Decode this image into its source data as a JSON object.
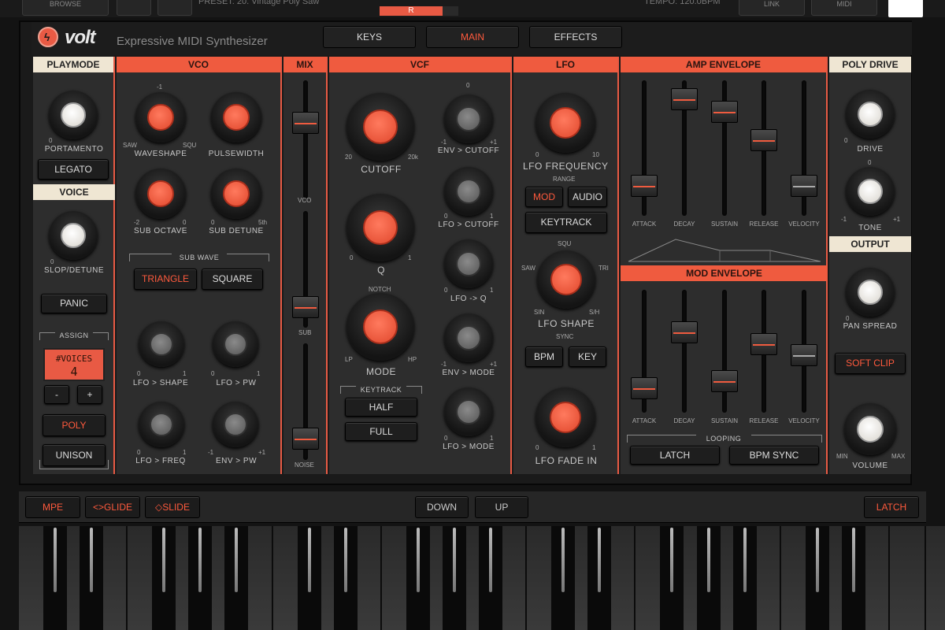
{
  "topbar": {
    "browse": "BROWSE",
    "preset": "PRESET: 20. Vintage Poly Saw",
    "meter": "R",
    "tempo": "TEMPO: 120.0BPM",
    "link": "LINK",
    "midi": "MIDI"
  },
  "header": {
    "brand": "volt",
    "tagline": "Expressive MIDI Synthesizer",
    "tabs": [
      {
        "label": "KEYS"
      },
      {
        "label": "MAIN"
      },
      {
        "label": "EFFECTS"
      }
    ],
    "active_tab": "MAIN"
  },
  "playmode": {
    "title": "PLAYMODE",
    "portamento": "PORTAMENTO",
    "portamento_min": "0",
    "legato": "LEGATO"
  },
  "voice": {
    "title": "VOICE",
    "slop": "SLOP/DETUNE",
    "slop_min": "0",
    "panic": "PANIC",
    "assign": "ASSIGN",
    "voices_label": "#VOICES",
    "voices_value": "4",
    "minus": "-",
    "plus": "+",
    "poly": "POLY",
    "unison": "UNISON"
  },
  "vco": {
    "title": "VCO",
    "waveshape": "WAVESHAPE",
    "waveshape_top": "-1",
    "saw": "SAW",
    "squ": "SQU",
    "pulsewidth": "PULSEWIDTH",
    "sub_octave": "SUB OCTAVE",
    "sub_min": "-2",
    "sub_max": "0",
    "sub_detune": "SUB DETUNE",
    "detune_min": "0",
    "detune_max": "5th",
    "sub_wave": "SUB WAVE",
    "triangle": "TRIANGLE",
    "square": "SQUARE",
    "lfo_shape": "LFO > SHAPE",
    "lfo_pw": "LFO > PW",
    "lfo_freq": "LFO > FREQ",
    "env_pw": "ENV > PW",
    "zero": "0",
    "one": "1",
    "neg1": "-1",
    "pos1": "+1"
  },
  "mix": {
    "title": "MIX",
    "vco": "VCO",
    "sub": "SUB",
    "noise": "NOISE"
  },
  "vcf": {
    "title": "VCF",
    "cutoff": "CUTOFF",
    "cutoff_min": "20",
    "cutoff_max": "20k",
    "q": "Q",
    "q_min": "0",
    "q_max": "1",
    "mode": "MODE",
    "notch": "NOTCH",
    "lp": "LP",
    "hp": "HP",
    "keytrack": "KEYTRACK",
    "half": "HALF",
    "full": "FULL",
    "env_cutoff": "ENV > CUTOFF",
    "lfo_cutoff": "LFO > CUTOFF",
    "lfo_q": "LFO -> Q",
    "env_mode": "ENV > MODE",
    "lfo_mode": "LFO > MODE",
    "zero": "0",
    "one": "1",
    "neg1": "-1",
    "pos1": "+1"
  },
  "lfo": {
    "title": "LFO",
    "frequency": "LFO FREQUENCY",
    "freq_min": "0",
    "freq_max": "10",
    "range": "RANGE",
    "mod": "MOD",
    "audio": "AUDIO",
    "keytrack": "KEYTRACK",
    "shape": "LFO SHAPE",
    "squ": "SQU",
    "saw": "SAW",
    "tri": "TRI",
    "sin": "SIN",
    "sh": "S/H",
    "sync": "SYNC",
    "bpm": "BPM",
    "key": "KEY",
    "fade_in": "LFO FADE IN",
    "zero": "0",
    "one": "1"
  },
  "amp_env": {
    "title": "AMP ENVELOPE",
    "labels": [
      "ATTACK",
      "DECAY",
      "SUSTAIN",
      "RELEASE",
      "VELOCITY"
    ],
    "levels": [
      0.17,
      0.93,
      0.82,
      0.57,
      0.17
    ]
  },
  "mod_env": {
    "title": "MOD ENVELOPE",
    "labels": [
      "ATTACK",
      "DECAY",
      "SUSTAIN",
      "RELEASE",
      "VELOCITY"
    ],
    "levels": [
      0.13,
      0.69,
      0.2,
      0.57,
      0.46
    ],
    "looping": "LOOPING",
    "latch": "LATCH",
    "bpm_sync": "BPM SYNC"
  },
  "poly_drive": {
    "title": "POLY DRIVE",
    "drive": "DRIVE",
    "drive_min": "0",
    "drive_top": "0",
    "tone": "TONE",
    "tone_min": "-1",
    "tone_max": "+1"
  },
  "output": {
    "title": "OUTPUT",
    "pan_spread": "PAN SPREAD",
    "pan_min": "0",
    "soft_clip": "SOFT CLIP",
    "volume": "VOLUME",
    "vol_min": "MIN",
    "vol_max": "MAX"
  },
  "keyboard": {
    "mpe": "MPE",
    "glide": "<>GLIDE",
    "slide": "◇SLIDE",
    "down": "DOWN",
    "up": "UP",
    "latch": "LATCH"
  },
  "colors": {
    "accent": "#ef5b3f",
    "beige": "#efe6d3",
    "panel": "#2d2d2d"
  }
}
